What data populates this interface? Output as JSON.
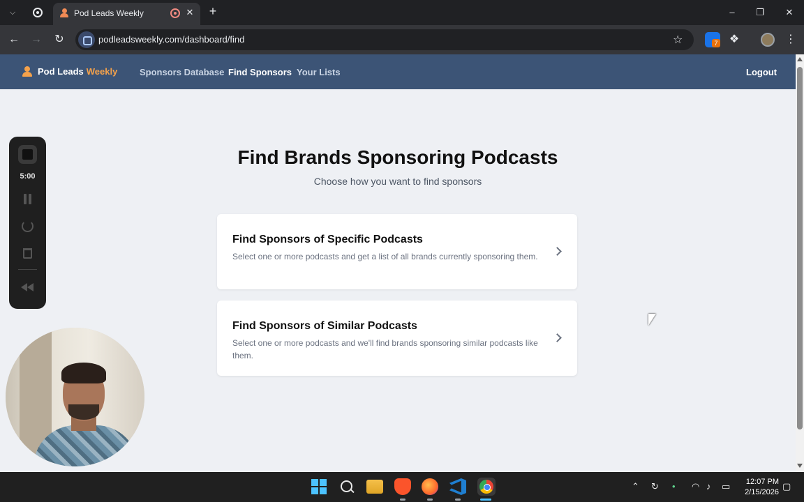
{
  "browser": {
    "tab_title": "Pod Leads Weekly",
    "url": "podleadsweekly.com/dashboard/find",
    "extension_badge": "7"
  },
  "header": {
    "brand_prefix": "Pod Leads",
    "brand_accent": "Weekly",
    "nav": [
      {
        "label": "Sponsors Database"
      },
      {
        "label": "Find Sponsors"
      },
      {
        "label": "Your Lists"
      }
    ],
    "logout_label": "Logout"
  },
  "main": {
    "title": "Find Brands Sponsoring Podcasts",
    "subtitle": "Choose how you want to find sponsors",
    "options": [
      {
        "title": "Find Sponsors of Specific Podcasts",
        "description": "Select one or more podcasts and get a list of all brands currently sponsoring them."
      },
      {
        "title": "Find Sponsors of Similar Podcasts",
        "description": "Select one or more podcasts and we'll find brands sponsoring similar podcasts like them."
      }
    ]
  },
  "recorder": {
    "time": "5:00"
  },
  "taskbar": {
    "time": "12:07 PM",
    "date": "2/15/2026"
  },
  "colors": {
    "header_bg": "#3c5476",
    "brand_accent": "#f5a24b",
    "page_bg": "#eef0f4"
  }
}
